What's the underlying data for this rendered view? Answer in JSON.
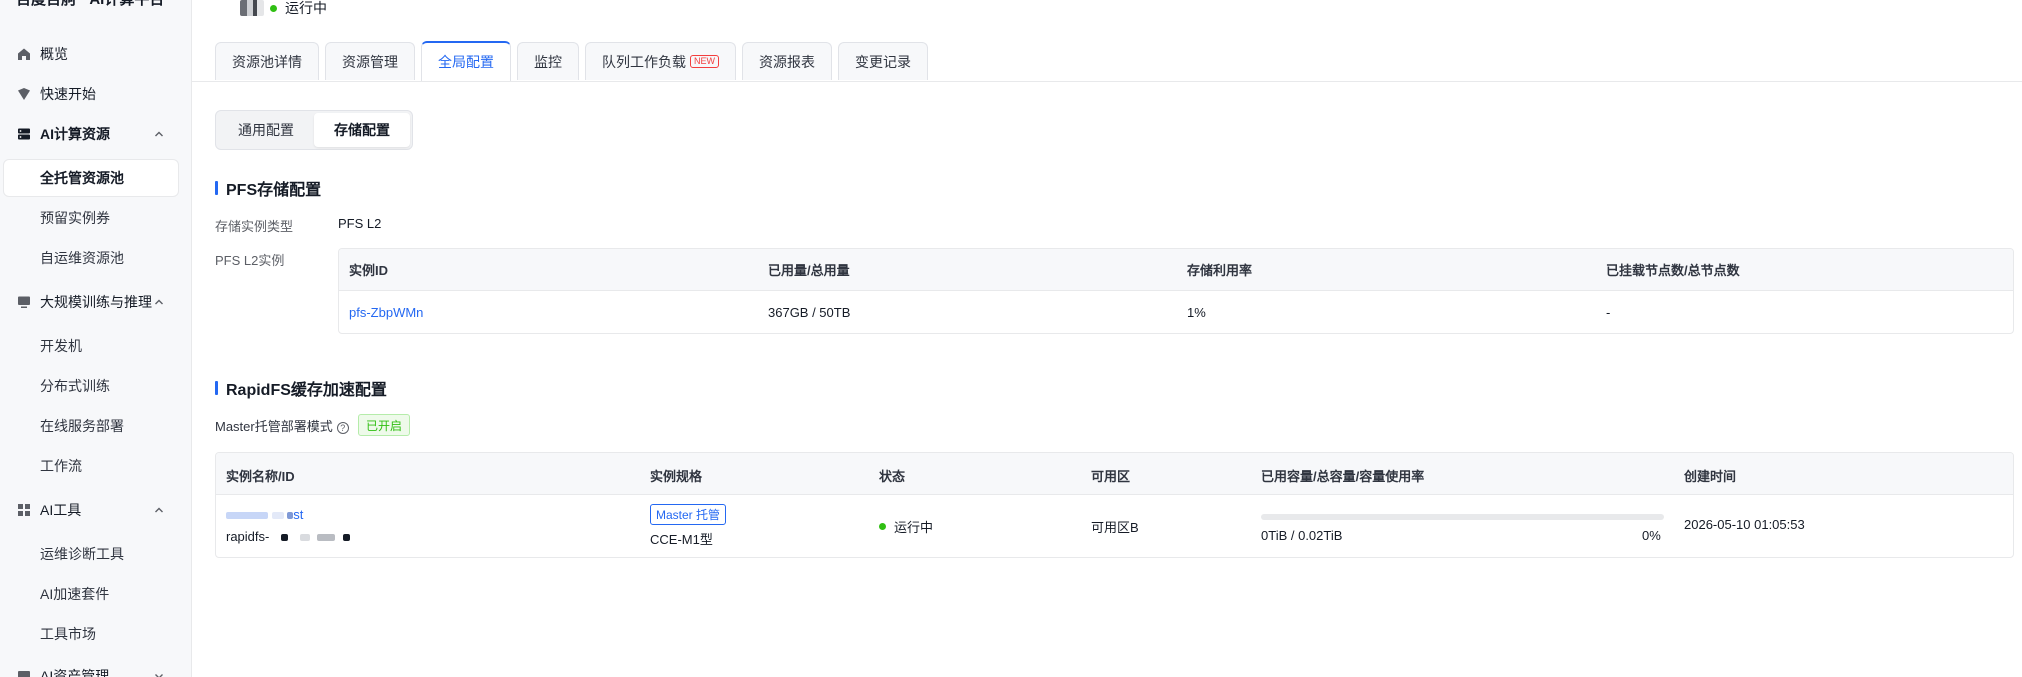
{
  "sidebar": {
    "brand": "百度百舸 · AI计算平台",
    "items": [
      {
        "label": "概览",
        "icon": "home-icon"
      },
      {
        "label": "快速开始",
        "icon": "shield-icon"
      },
      {
        "label": "AI计算资源",
        "icon": "server-icon"
      },
      {
        "label": "全托管资源池"
      },
      {
        "label": "预留实例券"
      },
      {
        "label": "自运维资源池"
      },
      {
        "label": "大规模训练与推理",
        "icon": "monitor-icon"
      },
      {
        "label": "开发机"
      },
      {
        "label": "分布式训练"
      },
      {
        "label": "在线服务部署"
      },
      {
        "label": "工作流"
      },
      {
        "label": "AI工具",
        "icon": "grid-icon"
      },
      {
        "label": "运维诊断工具"
      },
      {
        "label": "AI加速套件"
      },
      {
        "label": "工具市场"
      },
      {
        "label": "AI资产管理",
        "icon": "asset-icon"
      }
    ]
  },
  "header": {
    "status": "运行中",
    "tabs": [
      "资源池详情",
      "资源管理",
      "全局配置",
      "监控",
      "队列工作负载",
      "资源报表",
      "变更记录"
    ],
    "new_badge": "NEW",
    "active_tab": "全局配置"
  },
  "segment": {
    "options": [
      "通用配置",
      "存储配置"
    ],
    "active": "存储配置"
  },
  "pfs": {
    "title": "PFS存储配置",
    "type_label": "存储实例类型",
    "type_value": "PFS L2",
    "instance_label": "PFS L2实例",
    "columns": [
      "实例ID",
      "已用量/总用量",
      "存储利用率",
      "已挂载节点数/总节点数"
    ],
    "row": {
      "id": "pfs-ZbpWMn",
      "usage": "367GB / 50TB",
      "rate": "1%",
      "nodes": "-"
    }
  },
  "rapidfs": {
    "title": "RapidFS缓存加速配置",
    "mode_label": "Master托管部署模式",
    "mode_status": "已开启",
    "columns": [
      "实例名称/ID",
      "实例规格",
      "状态",
      "可用区",
      "已用容量/总容量/容量使用率",
      "创建时间"
    ],
    "row": {
      "name_suffix": "st",
      "id_prefix": "rapidfs-",
      "spec_tag": "Master 托管",
      "spec": "CCE-M1型",
      "status": "运行中",
      "zone": "可用区B",
      "capacity": "0TiB / 0.02TiB",
      "usage_percent_label": "0%",
      "usage_fraction": 0,
      "created": "2026-05-10 01:05:53"
    }
  }
}
